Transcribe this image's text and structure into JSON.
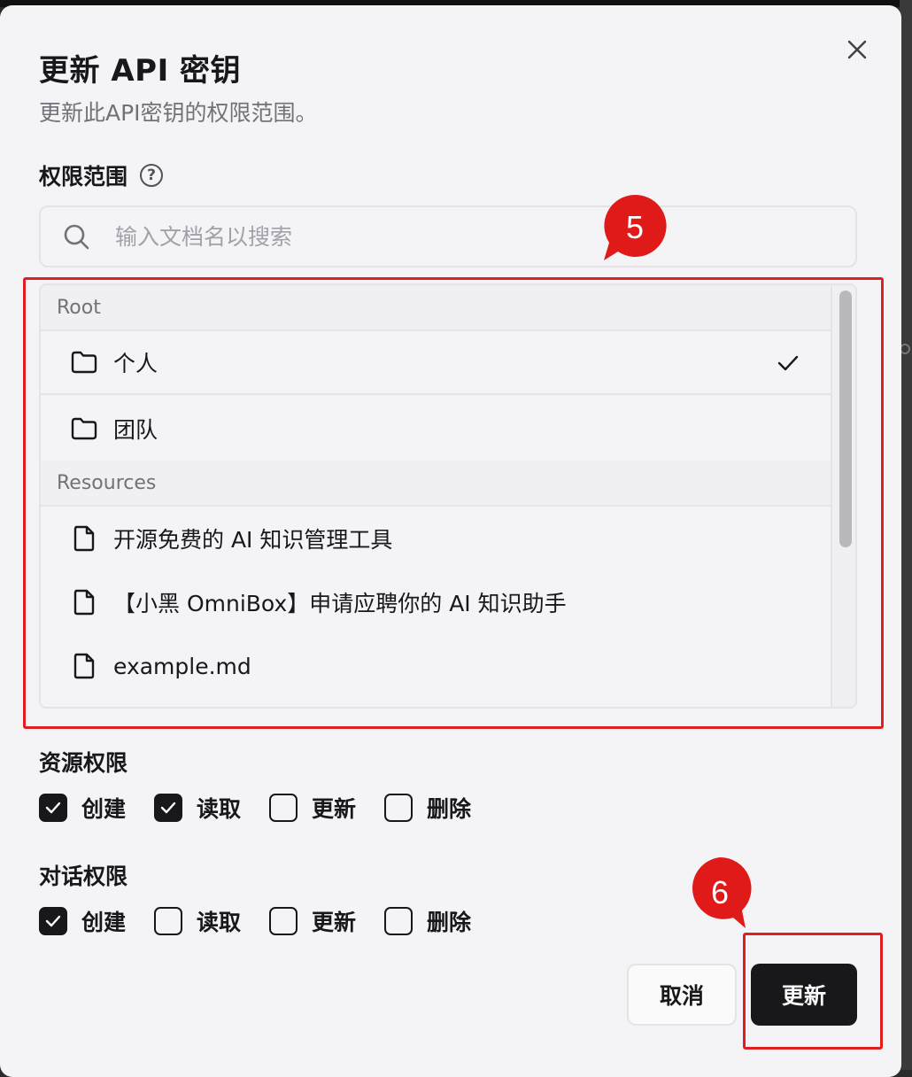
{
  "dialog": {
    "title": "更新 API 密钥",
    "subtitle": "更新此API密钥的权限范围。",
    "close_icon": "close-icon"
  },
  "scope": {
    "label": "权限范围",
    "help_icon": "?",
    "search_placeholder": "输入文档名以搜索",
    "groups": [
      {
        "heading": "Root",
        "items": [
          {
            "label": "个人",
            "icon": "folder-icon",
            "selected": true
          },
          {
            "label": "团队",
            "icon": "folder-icon",
            "selected": false
          }
        ]
      },
      {
        "heading": "Resources",
        "items": [
          {
            "label": "开源免费的 AI 知识管理工具",
            "icon": "file-icon"
          },
          {
            "label": "【小黑 OmniBox】申请应聘你的 AI 知识助手",
            "icon": "file-icon"
          },
          {
            "label": "example.md",
            "icon": "file-icon"
          }
        ]
      }
    ]
  },
  "resource_permissions": {
    "label": "资源权限",
    "options": [
      {
        "label": "创建",
        "checked": true
      },
      {
        "label": "读取",
        "checked": true
      },
      {
        "label": "更新",
        "checked": false
      },
      {
        "label": "删除",
        "checked": false
      }
    ]
  },
  "chat_permissions": {
    "label": "对话权限",
    "options": [
      {
        "label": "创建",
        "checked": true
      },
      {
        "label": "读取",
        "checked": false
      },
      {
        "label": "更新",
        "checked": false
      },
      {
        "label": "删除",
        "checked": false
      }
    ]
  },
  "buttons": {
    "cancel": "取消",
    "update": "更新"
  },
  "annotations": {
    "step_5": "5",
    "step_6": "6",
    "highlight_color": "#e02020"
  }
}
